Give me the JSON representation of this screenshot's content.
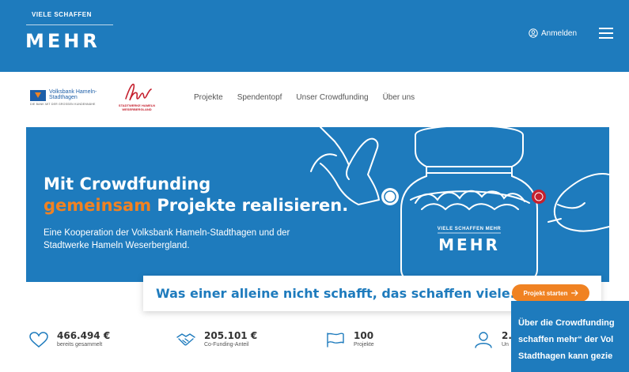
{
  "header": {
    "logo_small": "VIELE SCHAFFEN",
    "logo_big": "MEHR",
    "login_label": "Anmelden",
    "login_icon": "user-circle-icon",
    "menu_icon": "hamburger-icon",
    "background_color": "#1e7bbd"
  },
  "partners": {
    "volksbank_name": "Volksbank Hameln-Stadthagen",
    "volksbank_tagline": "DIE BANK MIT DER GROSSEN KUNDENNÄHE",
    "stadtwerke_name": "STADTWERKE HAMELN WESERBERGLAND"
  },
  "nav": {
    "items": [
      {
        "label": "Projekte"
      },
      {
        "label": "Spendentopf"
      },
      {
        "label": "Unser Crowdfunding"
      },
      {
        "label": "Über uns"
      }
    ]
  },
  "hero": {
    "title_line1": "Mit Crowdfunding",
    "title_accent": "gemeinsam",
    "title_rest": " Projekte realisieren.",
    "subtitle": "Eine Kooperation der Volksbank Hameln-Stadthagen und der Stadtwerke Hameln Weserbergland.",
    "jar_label_small": "VIELE SCHAFFEN MEHR",
    "jar_label_big": "MEHR",
    "accent_color": "#f08222"
  },
  "slogan": {
    "text": "Was einer alleine nicht schafft, das schaffen viele.",
    "button_label": "Projekt starten",
    "button_icon": "arrow-right-icon"
  },
  "stats": [
    {
      "value": "466.494 €",
      "label": "bereits gesammelt",
      "icon": "heart-icon"
    },
    {
      "value": "205.101 €",
      "label": "Co-Funding-Anteil",
      "icon": "handshake-icon"
    },
    {
      "value": "100",
      "label": "Projekte",
      "icon": "flag-icon"
    },
    {
      "value": "2.",
      "label": "Un",
      "icon": "person-icon"
    }
  ],
  "overlay": {
    "lines": [
      "Über die Crowdfunding",
      "schaffen mehr“ der Vol",
      "Stadthagen kann gezie"
    ]
  }
}
